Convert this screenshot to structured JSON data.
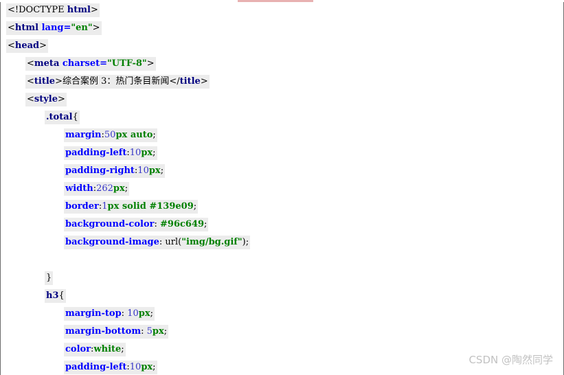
{
  "code_lines": [
    {
      "indent": 0,
      "tokens": [
        [
          "plain",
          "<!DOCTYPE "
        ],
        [
          "tag",
          "html"
        ],
        [
          "plain",
          ">"
        ]
      ]
    },
    {
      "indent": 0,
      "tokens": [
        [
          "plain",
          "<"
        ],
        [
          "tag",
          "html "
        ],
        [
          "attr",
          "lang="
        ],
        [
          "str",
          "\"en\""
        ],
        [
          "plain",
          ">"
        ]
      ]
    },
    {
      "indent": 0,
      "tokens": [
        [
          "plain",
          "<"
        ],
        [
          "tag",
          "head"
        ],
        [
          "plain",
          ">"
        ]
      ]
    },
    {
      "indent": 1,
      "tokens": [
        [
          "plain",
          "<"
        ],
        [
          "tag",
          "meta "
        ],
        [
          "attr",
          "charset="
        ],
        [
          "str",
          "\"UTF-8\""
        ],
        [
          "plain",
          ">"
        ]
      ]
    },
    {
      "indent": 1,
      "tokens": [
        [
          "plain",
          "<"
        ],
        [
          "tag",
          "title"
        ],
        [
          "plain",
          ">综合案例 3：热门条目新闻</"
        ],
        [
          "tag",
          "title"
        ],
        [
          "plain",
          ">"
        ]
      ]
    },
    {
      "indent": 1,
      "tokens": [
        [
          "plain",
          "<"
        ],
        [
          "tag",
          "style"
        ],
        [
          "plain",
          ">"
        ]
      ]
    },
    {
      "indent": 2,
      "tokens": [
        [
          "sel",
          ".total"
        ],
        [
          "plain",
          "{"
        ]
      ]
    },
    {
      "indent": 3,
      "tokens": [
        [
          "prop",
          "margin"
        ],
        [
          "plain",
          ":"
        ],
        [
          "num",
          "50"
        ],
        [
          "unit",
          "px auto"
        ],
        [
          "plain",
          ";"
        ]
      ]
    },
    {
      "indent": 3,
      "tokens": [
        [
          "prop",
          "padding-left"
        ],
        [
          "plain",
          ":"
        ],
        [
          "num",
          "10"
        ],
        [
          "unit",
          "px"
        ],
        [
          "plain",
          ";"
        ]
      ]
    },
    {
      "indent": 3,
      "tokens": [
        [
          "prop",
          "padding-right"
        ],
        [
          "plain",
          ":"
        ],
        [
          "num",
          "10"
        ],
        [
          "unit",
          "px"
        ],
        [
          "plain",
          ";"
        ]
      ]
    },
    {
      "indent": 3,
      "tokens": [
        [
          "prop",
          "width"
        ],
        [
          "plain",
          ":"
        ],
        [
          "num",
          "262"
        ],
        [
          "unit",
          "px"
        ],
        [
          "plain",
          ";"
        ]
      ]
    },
    {
      "indent": 3,
      "tokens": [
        [
          "prop",
          "border"
        ],
        [
          "plain",
          ":"
        ],
        [
          "num",
          "1"
        ],
        [
          "unit",
          "px solid #139e09"
        ],
        [
          "plain",
          ";"
        ]
      ]
    },
    {
      "indent": 3,
      "tokens": [
        [
          "prop",
          "background-color"
        ],
        [
          "plain",
          ": "
        ],
        [
          "val",
          "#96c649"
        ],
        [
          "plain",
          ";"
        ]
      ]
    },
    {
      "indent": 3,
      "tokens": [
        [
          "prop",
          "background-image"
        ],
        [
          "plain",
          ": url("
        ],
        [
          "str",
          "\"img/bg.gif\""
        ],
        [
          "plain",
          ");"
        ]
      ]
    },
    {
      "indent": 0,
      "tokens": []
    },
    {
      "indent": 2,
      "tokens": [
        [
          "plain",
          "}"
        ]
      ]
    },
    {
      "indent": 2,
      "tokens": [
        [
          "sel",
          "h3"
        ],
        [
          "plain",
          "{"
        ]
      ]
    },
    {
      "indent": 3,
      "tokens": [
        [
          "prop",
          "margin-top"
        ],
        [
          "plain",
          ": "
        ],
        [
          "num",
          "10"
        ],
        [
          "unit",
          "px"
        ],
        [
          "plain",
          ";"
        ]
      ]
    },
    {
      "indent": 3,
      "tokens": [
        [
          "prop",
          "margin-bottom"
        ],
        [
          "plain",
          ": "
        ],
        [
          "num",
          "5"
        ],
        [
          "unit",
          "px"
        ],
        [
          "plain",
          ";"
        ]
      ]
    },
    {
      "indent": 3,
      "tokens": [
        [
          "prop",
          "color"
        ],
        [
          "plain",
          ":"
        ],
        [
          "val",
          "white"
        ],
        [
          "plain",
          ";"
        ]
      ]
    },
    {
      "indent": 3,
      "tokens": [
        [
          "prop",
          "padding-left"
        ],
        [
          "plain",
          ":"
        ],
        [
          "num",
          "10"
        ],
        [
          "unit",
          "px"
        ],
        [
          "plain",
          ";"
        ]
      ]
    }
  ],
  "watermark": "CSDN @陶然同学"
}
